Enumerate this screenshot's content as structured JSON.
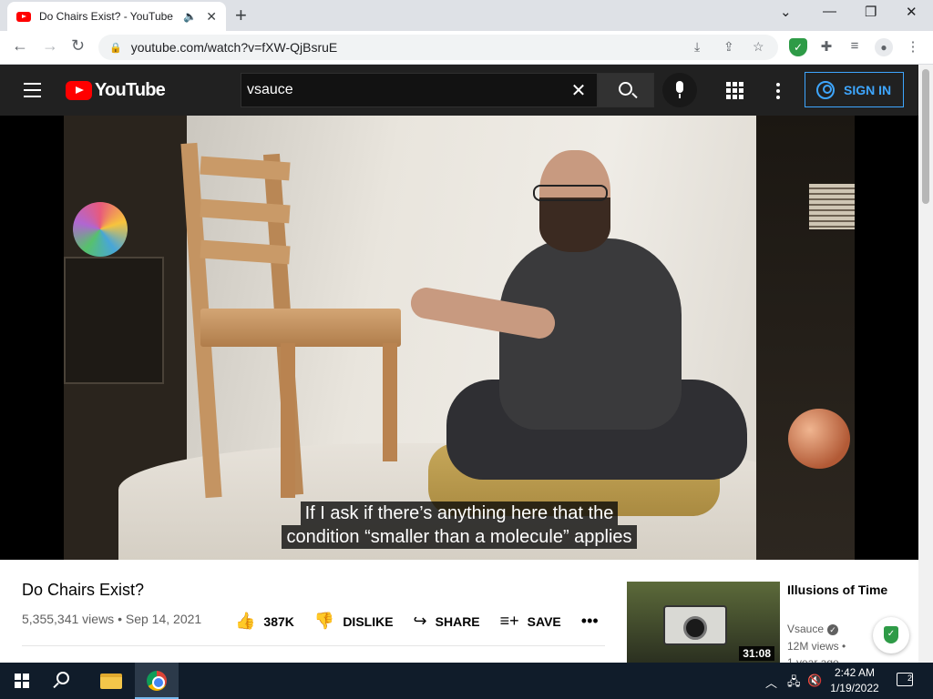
{
  "browser": {
    "tab_title": "Do Chairs Exist? - YouTube",
    "url": "youtube.com/watch?v=fXW-QjBsruE"
  },
  "masthead": {
    "logo_text": "YouTube",
    "search_value": "vsauce",
    "sign_in_label": "SIGN IN"
  },
  "player": {
    "caption_line1": "If I ask if there’s anything here that the",
    "caption_line2": "condition “smaller than a molecule” applies"
  },
  "video": {
    "title": "Do Chairs Exist?",
    "views": "5,355,341 views",
    "date": "Sep 14, 2021",
    "separator": "•",
    "actions": {
      "like_count": "387K",
      "dislike_label": "DISLIKE",
      "share_label": "SHARE",
      "save_label": "SAVE"
    }
  },
  "recommendation": {
    "title": "Illusions of Time",
    "channel": "Vsauce",
    "views": "12M views •",
    "age": "1 year ago",
    "duration": "31:08"
  },
  "taskbar": {
    "time": "2:42 AM",
    "date": "1/19/2022",
    "notification_count": "2"
  },
  "colors": {
    "youtube_red": "#ff0000",
    "masthead_bg": "#212121",
    "signin_blue": "#3ea6ff",
    "taskbar_bg": "#101c2a"
  }
}
